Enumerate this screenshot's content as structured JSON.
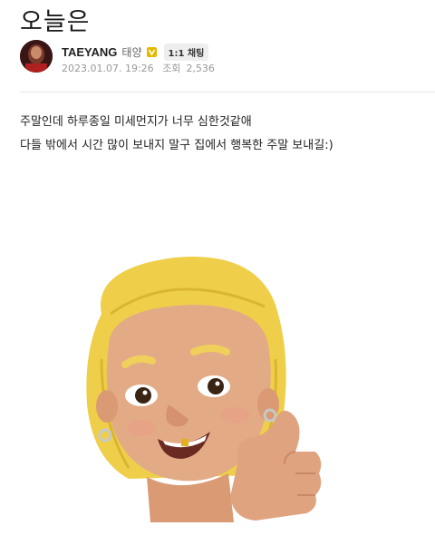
{
  "post": {
    "title": "오늘은",
    "author": {
      "name": "TAEYANG",
      "name_kr": "태양",
      "verified_icon": "verified-badge-icon",
      "chat_label": "1:1 채팅"
    },
    "meta": {
      "date": "2023.01.07. 19:26",
      "views_label": "조회",
      "views": "2,536"
    },
    "body_lines": [
      "주말인데 하루종일 미세먼지가 너무 심한것같애",
      "다들 밖에서 시간 많이 보내지 말구 집에서 행복한 주말 보내길:)"
    ]
  },
  "colors": {
    "badge": "#e5b800",
    "hair": "#f2d24c",
    "skin": "#dea47f"
  }
}
